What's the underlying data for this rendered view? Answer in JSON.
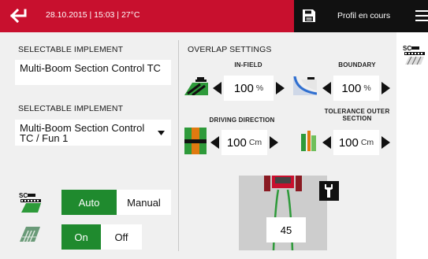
{
  "topbar": {
    "status_text": "28.10.2015 | 15:03 | 27°C",
    "profile_label": "Profil en cours"
  },
  "left": {
    "implement1": {
      "title": "SELECTABLE IMPLEMENT",
      "value": "Multi-Boom Section Control TC"
    },
    "implement2": {
      "title": "SELECTABLE IMPLEMENT",
      "value": "Multi-Boom Section Control TC / Fun 1"
    },
    "mode_toggle": {
      "auto_label": "Auto",
      "manual_label": "Manual",
      "selected": "Auto"
    },
    "onoff_toggle": {
      "on_label": "On",
      "off_label": "Off",
      "selected": "On"
    }
  },
  "overlap": {
    "title": "OVERLAP SETTINGS",
    "in_field": {
      "label": "IN-FIELD",
      "value": "100",
      "unit": "%"
    },
    "boundary": {
      "label": "BOUNDARY",
      "value": "100",
      "unit": "%"
    },
    "driving_direction": {
      "label": "DRIVING DIRECTION",
      "value": "100",
      "unit": "Cm"
    },
    "tolerance_outer": {
      "label": "TOLERANCE OUTER SECTION",
      "label_line1": "TOLERANCE OUTER",
      "label_line2": "SECTION",
      "value": "100",
      "unit": "Cm"
    }
  },
  "tractor_panel": {
    "lookahead_value": "45"
  },
  "colors": {
    "brand_red": "#c8102e",
    "active_green": "#1f8a2e",
    "panel_gray": "#f0f0f0"
  },
  "icons": [
    "back-arrow-icon",
    "save-icon",
    "menu-icon",
    "section-control-icon",
    "infield-overlap-icon",
    "boundary-overlap-icon",
    "driving-direction-icon",
    "tolerance-outer-icon",
    "wrench-icon",
    "field-coverage-icon",
    "tractor-icon"
  ]
}
